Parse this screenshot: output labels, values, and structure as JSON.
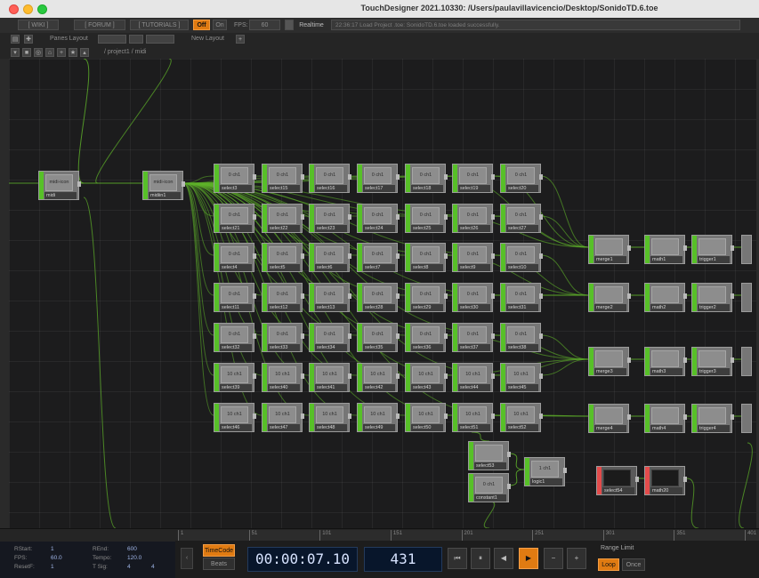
{
  "window": {
    "title": "TouchDesigner 2021.10330: /Users/paulavillavicencio/Desktop/SonidoTD.6.toe"
  },
  "menubar": {
    "wiki": "[ WIKI ]",
    "forum": "[ FORUM ]",
    "tutorials": "[ TUTORIALS ]",
    "off": "Off",
    "on": "On",
    "fps_label": "FPS:",
    "fps_value": "60",
    "realtime": "Realtime",
    "message": "22:36:17 Load Project .toe: SonidoTD.6.toe loaded successfully."
  },
  "panebar": {
    "panes_layout": "Panes Layout",
    "new_layout": "New Layout",
    "add": "+"
  },
  "pathbar": {
    "path": "/ project1 / midi"
  },
  "network": {
    "midi_in": {
      "name": "midi",
      "icon": "midi-icon"
    },
    "midi_out": {
      "name": "midiin1",
      "icon": "midi-icon"
    },
    "select_label": "0 ch1",
    "select_grid": [
      [
        "select3",
        "select15",
        "select16",
        "select17",
        "select18",
        "select19",
        "select20"
      ],
      [
        "select21",
        "select22",
        "select23",
        "select24",
        "select25",
        "select26",
        "select27"
      ],
      [
        "select4",
        "select5",
        "select6",
        "select7",
        "select8",
        "select9",
        "select10"
      ],
      [
        "select11",
        "select12",
        "select13",
        "select28",
        "select29",
        "select30",
        "select31"
      ],
      [
        "select32",
        "select33",
        "select34",
        "select35",
        "select36",
        "select37",
        "select38"
      ],
      [
        "select39",
        "select40",
        "select41",
        "select42",
        "select43",
        "select44",
        "select45"
      ],
      [
        "select46",
        "select47",
        "select48",
        "select49",
        "select50",
        "select51",
        "select52"
      ]
    ],
    "row_labels": [
      "0 ch1",
      "0 ch1",
      "0 ch1",
      "0 ch1",
      "0 ch1",
      "10 ch1",
      "10 ch1"
    ],
    "chain_rows": [
      [
        "merge1",
        "math1",
        "trigger1"
      ],
      [
        "merge2",
        "math2",
        "trigger2"
      ],
      [
        "merge3",
        "math3",
        "trigger3"
      ],
      [
        "merge4",
        "math4",
        "trigger4"
      ]
    ],
    "extra_nodes": {
      "select53": "select53",
      "constant1": "constant1",
      "logic1": "logic1",
      "select54": "select54",
      "math20": "math20"
    },
    "logic_label": "1 ch1"
  },
  "timeline": {
    "ticks": [
      "1",
      "51",
      "101",
      "151",
      "201",
      "251",
      "301",
      "351",
      "401"
    ]
  },
  "info": {
    "start_label": "Start:",
    "start": "1",
    "end_label": "End:",
    "end": "600",
    "rstart_label": "RStart:",
    "rstart": "1",
    "rend_label": "REnd:",
    "rend": "600",
    "fps_label": "FPS:",
    "fps": "60.0",
    "tempo_label": "Tempo:",
    "tempo": "120.0",
    "resetf_label": "ResetF:",
    "resetf": "1",
    "tsig_label": "T Sig:",
    "tsig_a": "4",
    "tsig_b": "4"
  },
  "transport": {
    "timecode": "TimeCode",
    "beats": "Beats",
    "time": "00:00:07.10",
    "frame": "431",
    "range_limit": "Range Limit",
    "loop": "Loop",
    "once": "Once",
    "buttons": [
      "⏮",
      "⏸",
      "◀",
      "▶",
      "−",
      "+"
    ]
  },
  "colors": {
    "wire": "#5fb32a",
    "op_bar_chop": "#57c028",
    "accent_orange": "#e07b12"
  }
}
